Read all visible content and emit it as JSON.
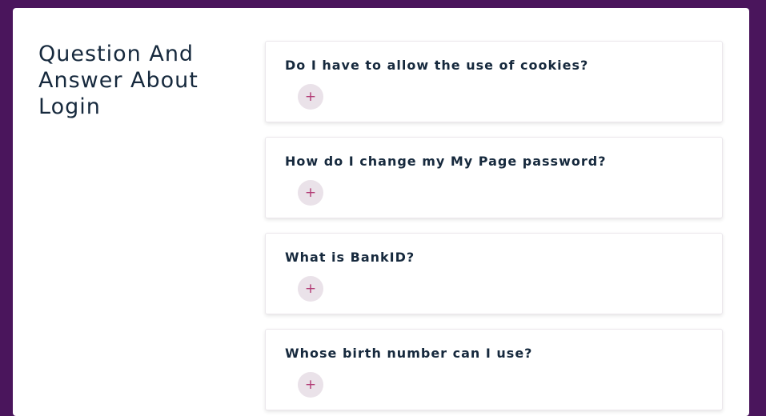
{
  "page": {
    "title": "Question And Answer About Login"
  },
  "faq": {
    "items": [
      {
        "question": "Do I have to allow the use of cookies?",
        "expand_icon": "+"
      },
      {
        "question": "How do I change my My Page password?",
        "expand_icon": "+"
      },
      {
        "question": "What is BankID?",
        "expand_icon": "+"
      },
      {
        "question": "Whose birth number can I use?",
        "expand_icon": "+"
      }
    ]
  },
  "colors": {
    "background": "#4a155c",
    "panel": "#ffffff",
    "text": "#16293d",
    "icon_accent": "#b23a74",
    "icon_bg": "#eae2e9"
  },
  "icons": {
    "expand": "plus-icon"
  }
}
